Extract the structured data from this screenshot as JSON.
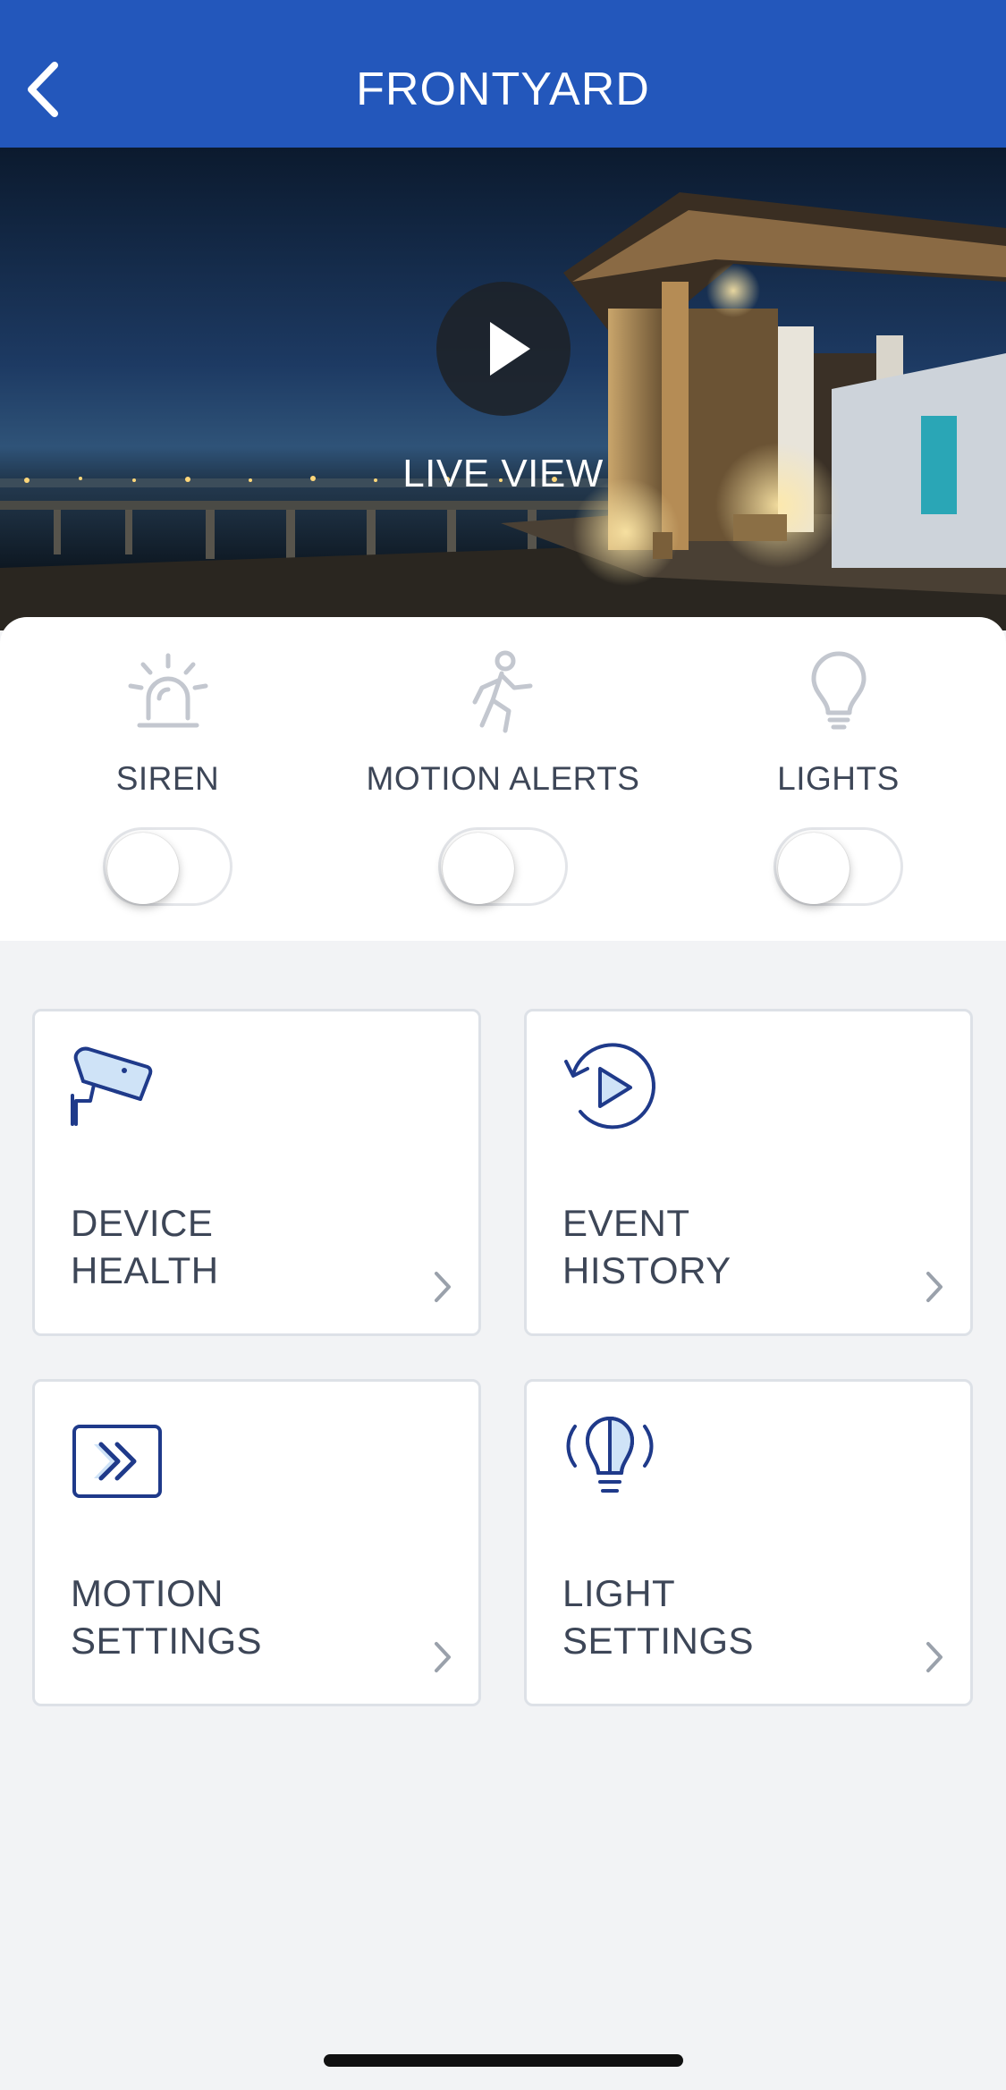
{
  "header": {
    "title": "FRONTYARD",
    "back_icon": "chevron-left-icon",
    "background_color": "#2357bb"
  },
  "live_view": {
    "label": "LIVE VIEW",
    "play_icon": "play-icon"
  },
  "controls": [
    {
      "label": "SIREN",
      "icon": "siren-icon",
      "on": false
    },
    {
      "label": "MOTION ALERTS",
      "icon": "running-person-icon",
      "on": false
    },
    {
      "label": "LIGHTS",
      "icon": "lightbulb-icon",
      "on": false
    }
  ],
  "tiles": [
    {
      "line1": "DEVICE",
      "line2": "HEALTH",
      "icon": "camera-icon"
    },
    {
      "line1": "EVENT",
      "line2": "HISTORY",
      "icon": "history-play-icon"
    },
    {
      "line1": "MOTION",
      "line2": "SETTINGS",
      "icon": "motion-arrows-icon"
    },
    {
      "line1": "LIGHT",
      "line2": "SETTINGS",
      "icon": "light-bulb-icon"
    }
  ],
  "colors": {
    "accent": "#1f3a8a",
    "icon_fill": "#cfe3f7",
    "page_background": "#f2f3f5"
  }
}
